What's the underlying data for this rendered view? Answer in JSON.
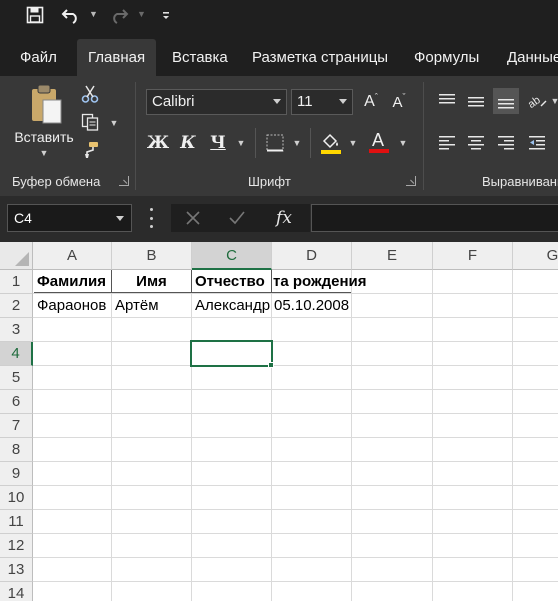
{
  "qat": {
    "save_icon": "save-icon",
    "undo_icon": "undo-icon",
    "redo_icon": "redo-icon",
    "customize_icon": "customize-qat-icon"
  },
  "tabs": [
    {
      "label": "Файл"
    },
    {
      "label": "Главная"
    },
    {
      "label": "Вставка"
    },
    {
      "label": "Разметка страницы"
    },
    {
      "label": "Формулы"
    },
    {
      "label": "Данные"
    }
  ],
  "ribbon": {
    "clipboard": {
      "paste_label": "Вставить",
      "group_label": "Буфер обмена"
    },
    "font": {
      "font_name": "Calibri",
      "font_size": "11",
      "bold": "Ж",
      "italic": "К",
      "underline": "Ч",
      "group_label": "Шрифт",
      "fill_color": "#ffd700",
      "font_color": "#e01010"
    },
    "alignment": {
      "group_label": "Выравнивани"
    }
  },
  "formula_bar": {
    "name_box": "C4",
    "fx_label": "fx",
    "formula": ""
  },
  "sheet": {
    "columns": [
      "A",
      "B",
      "C",
      "D",
      "E",
      "F",
      "G"
    ],
    "rows": [
      "1",
      "2",
      "3",
      "4",
      "5",
      "6",
      "7",
      "8",
      "9",
      "10",
      "11",
      "12",
      "13",
      "14"
    ],
    "selected_cell": "C4",
    "cells": {
      "A1": "Фамилия",
      "B1": "Имя",
      "C1": "Отчество",
      "D1": "та рождения",
      "A2": "Фараонов",
      "B2": "Артём",
      "C2": "Александр",
      "D2": "05.10.2008"
    }
  }
}
